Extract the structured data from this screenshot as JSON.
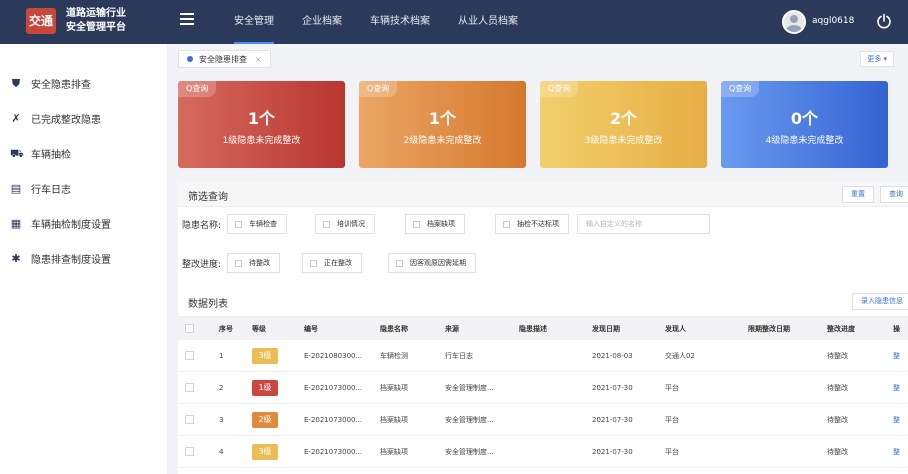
{
  "app": {
    "logo_text": "交通",
    "title_line1": "道路运输行业",
    "title_line2": "安全管理平台",
    "user": "aqgl0618"
  },
  "nav": [
    {
      "label": "安全管理",
      "active": true
    },
    {
      "label": "企业档案",
      "active": false
    },
    {
      "label": "车辆技术档案",
      "active": false
    },
    {
      "label": "从业人员档案",
      "active": false
    }
  ],
  "sidebar": {
    "items": [
      {
        "label": "安全隐患排查",
        "icon": "shield-icon"
      },
      {
        "label": "已完成整改隐患",
        "icon": "wrench-icon"
      },
      {
        "label": "车辆抽检",
        "icon": "truck-icon"
      },
      {
        "label": "行车日志",
        "icon": "log-icon"
      },
      {
        "label": "车辆抽检制度设置",
        "icon": "calendar-icon"
      },
      {
        "label": "隐患排查制度设置",
        "icon": "gear-icon"
      }
    ]
  },
  "tabs": [
    {
      "label": "安全隐患排查"
    }
  ],
  "more_label": "更多 ▾",
  "cards": [
    {
      "tag": "Q查询",
      "count": "1个",
      "label": "1级隐患未完成整改",
      "color": "#c9473f"
    },
    {
      "tag": "Q查询",
      "count": "1个",
      "label": "2级隐患未完成整改",
      "color": "#de8a3f"
    },
    {
      "tag": "Q查询",
      "count": "2个",
      "label": "3级隐患未完成整改",
      "color": "#ecbd55"
    },
    {
      "tag": "Q查询",
      "count": "0个",
      "label": "4级隐患未完成整改",
      "color": "#3f74db"
    }
  ],
  "filter": {
    "title": "筛选查询",
    "reset_label": "重置",
    "query_label": "查询",
    "name_label": "隐患名称:",
    "name_options": [
      "车辆检查",
      "培训情况",
      "档案缺项",
      "抽检不达标项"
    ],
    "custom_placeholder": "输入自定义的名称",
    "progress_label": "整改进度:",
    "progress_options": [
      "待整改",
      "正在整改",
      "因客观原因需延期"
    ]
  },
  "datalist": {
    "title": "数据列表",
    "add_label": "录入隐患信息",
    "columns": [
      "序号",
      "等级",
      "编号",
      "隐患名称",
      "来源",
      "隐患描述",
      "发现日期",
      "发现人",
      "限期整改日期",
      "整改进度",
      "操"
    ],
    "rows": [
      {
        "no": "1",
        "level": "3级",
        "level_color": "#ecbd55",
        "code": "E-2021080300...",
        "name": "车辆检测",
        "source": "行车日志",
        "desc": "",
        "date": "2021-08-03",
        "finder": "交通人02",
        "deadline": "",
        "progress": "待整改",
        "op": "整"
      },
      {
        "no": "2",
        "level": "1级",
        "level_color": "#c9473f",
        "code": "E-2021073000...",
        "name": "档案缺项",
        "source": "安全管理制度...",
        "desc": "",
        "date": "2021-07-30",
        "finder": "平台",
        "deadline": "",
        "progress": "待整改",
        "op": "整"
      },
      {
        "no": "3",
        "level": "2级",
        "level_color": "#de8a3f",
        "code": "E-2021073000...",
        "name": "档案缺项",
        "source": "安全管理制度...",
        "desc": "",
        "date": "2021-07-30",
        "finder": "平台",
        "deadline": "",
        "progress": "待整改",
        "op": "整"
      },
      {
        "no": "4",
        "level": "3级",
        "level_color": "#ecbd55",
        "code": "E-2021073000...",
        "name": "档案缺项",
        "source": "安全管理制度...",
        "desc": "",
        "date": "2021-07-30",
        "finder": "平台",
        "deadline": "",
        "progress": "待整改",
        "op": "整"
      }
    ]
  }
}
